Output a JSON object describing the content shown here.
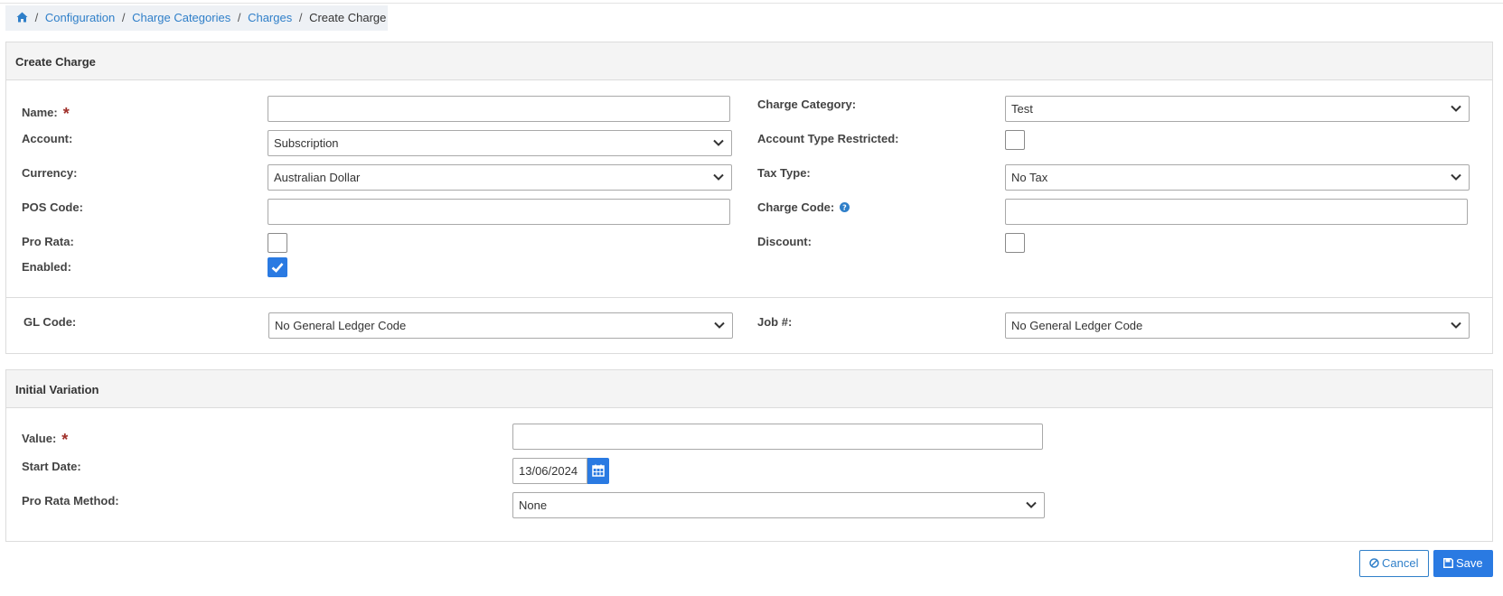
{
  "breadcrumb": {
    "home_icon": "home-icon",
    "items": [
      "Configuration",
      "Charge Categories",
      "Charges"
    ],
    "current": "Create Charge",
    "separator": "/"
  },
  "create_charge": {
    "title": "Create Charge",
    "required_mark": "*",
    "name": {
      "label": "Name:",
      "value": ""
    },
    "account": {
      "label": "Account:",
      "value": "Subscription"
    },
    "currency": {
      "label": "Currency:",
      "value": "Australian Dollar"
    },
    "pos_code": {
      "label": "POS Code:",
      "value": ""
    },
    "pro_rata": {
      "label": "Pro Rata:",
      "checked": false
    },
    "enabled": {
      "label": "Enabled:",
      "checked": true
    },
    "charge_category": {
      "label": "Charge Category:",
      "value": "Test"
    },
    "account_type_restricted": {
      "label": "Account Type Restricted:",
      "checked": false
    },
    "tax_type": {
      "label": "Tax Type:",
      "value": "No Tax"
    },
    "charge_code": {
      "label": "Charge Code:",
      "value": "",
      "help_icon": "question-circle-icon"
    },
    "discount": {
      "label": "Discount:",
      "checked": false
    },
    "gl_code": {
      "label": "GL Code:",
      "value": "No General Ledger Code"
    },
    "job": {
      "label": "Job #:",
      "value": "No General Ledger Code"
    }
  },
  "initial_variation": {
    "title": "Initial Variation",
    "value": {
      "label": "Value:",
      "value": ""
    },
    "start_date": {
      "label": "Start Date:",
      "value": "13/06/2024",
      "icon": "calendar-icon"
    },
    "pro_rata_method": {
      "label": "Pro Rata Method:",
      "value": "None"
    }
  },
  "actions": {
    "cancel_label": "Cancel",
    "cancel_icon": "ban-icon",
    "save_label": "Save",
    "save_icon": "floppy-disk-icon"
  },
  "colors": {
    "accent": "#2a7ae2",
    "link": "#2f7fc9",
    "required": "#a0302a",
    "panel_header_bg": "#f4f4f4",
    "breadcrumb_bg": "#eef1f5"
  }
}
